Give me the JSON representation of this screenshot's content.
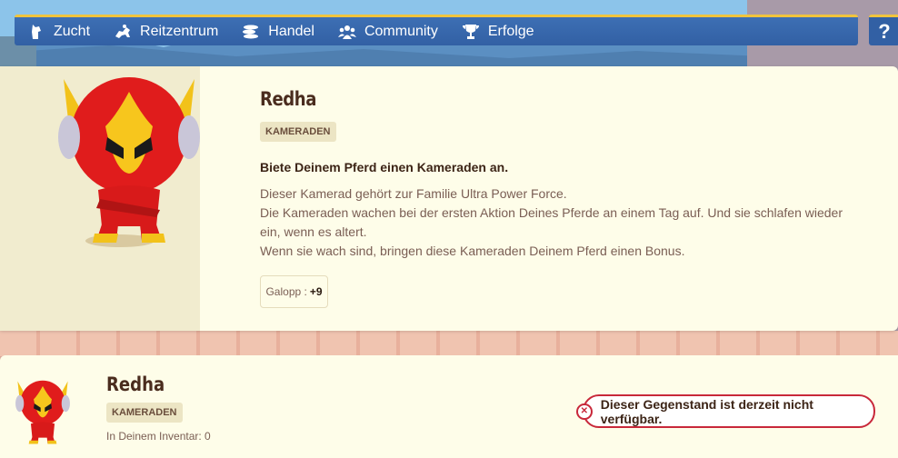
{
  "nav": {
    "items": [
      {
        "label": "Zucht",
        "icon": "horse-head-icon"
      },
      {
        "label": "Reitzentrum",
        "icon": "horse-rider-icon"
      },
      {
        "label": "Handel",
        "icon": "coins-icon"
      },
      {
        "label": "Community",
        "icon": "group-icon"
      },
      {
        "label": "Erfolge",
        "icon": "trophy-icon"
      }
    ],
    "help_label": "?"
  },
  "item": {
    "name": "Redha",
    "category": "KAMERADEN",
    "headline": "Biete Deinem Pferd einen Kameraden an.",
    "description": [
      "Dieser Kamerad gehört zur Familie Ultra Power Force.",
      "Die Kameraden wachen bei der ersten Aktion Deines Pferde an einem Tag auf. Und sie schlafen wieder ein, wenn es altert.",
      "Wenn sie wach sind, bringen diese Kameraden Deinem Pferd einen Bonus."
    ],
    "stat_label": "Galopp :",
    "stat_value": "+9"
  },
  "shop": {
    "name": "Redha",
    "category": "KAMERADEN",
    "inventory": "In Deinem Inventar: 0",
    "alert": "Dieser Gegenstand ist derzeit nicht verfügbar."
  },
  "colors": {
    "nav": "#3260a4",
    "accent": "#f0c43c",
    "alert": "#c8283a",
    "panel": "#fefde9"
  }
}
